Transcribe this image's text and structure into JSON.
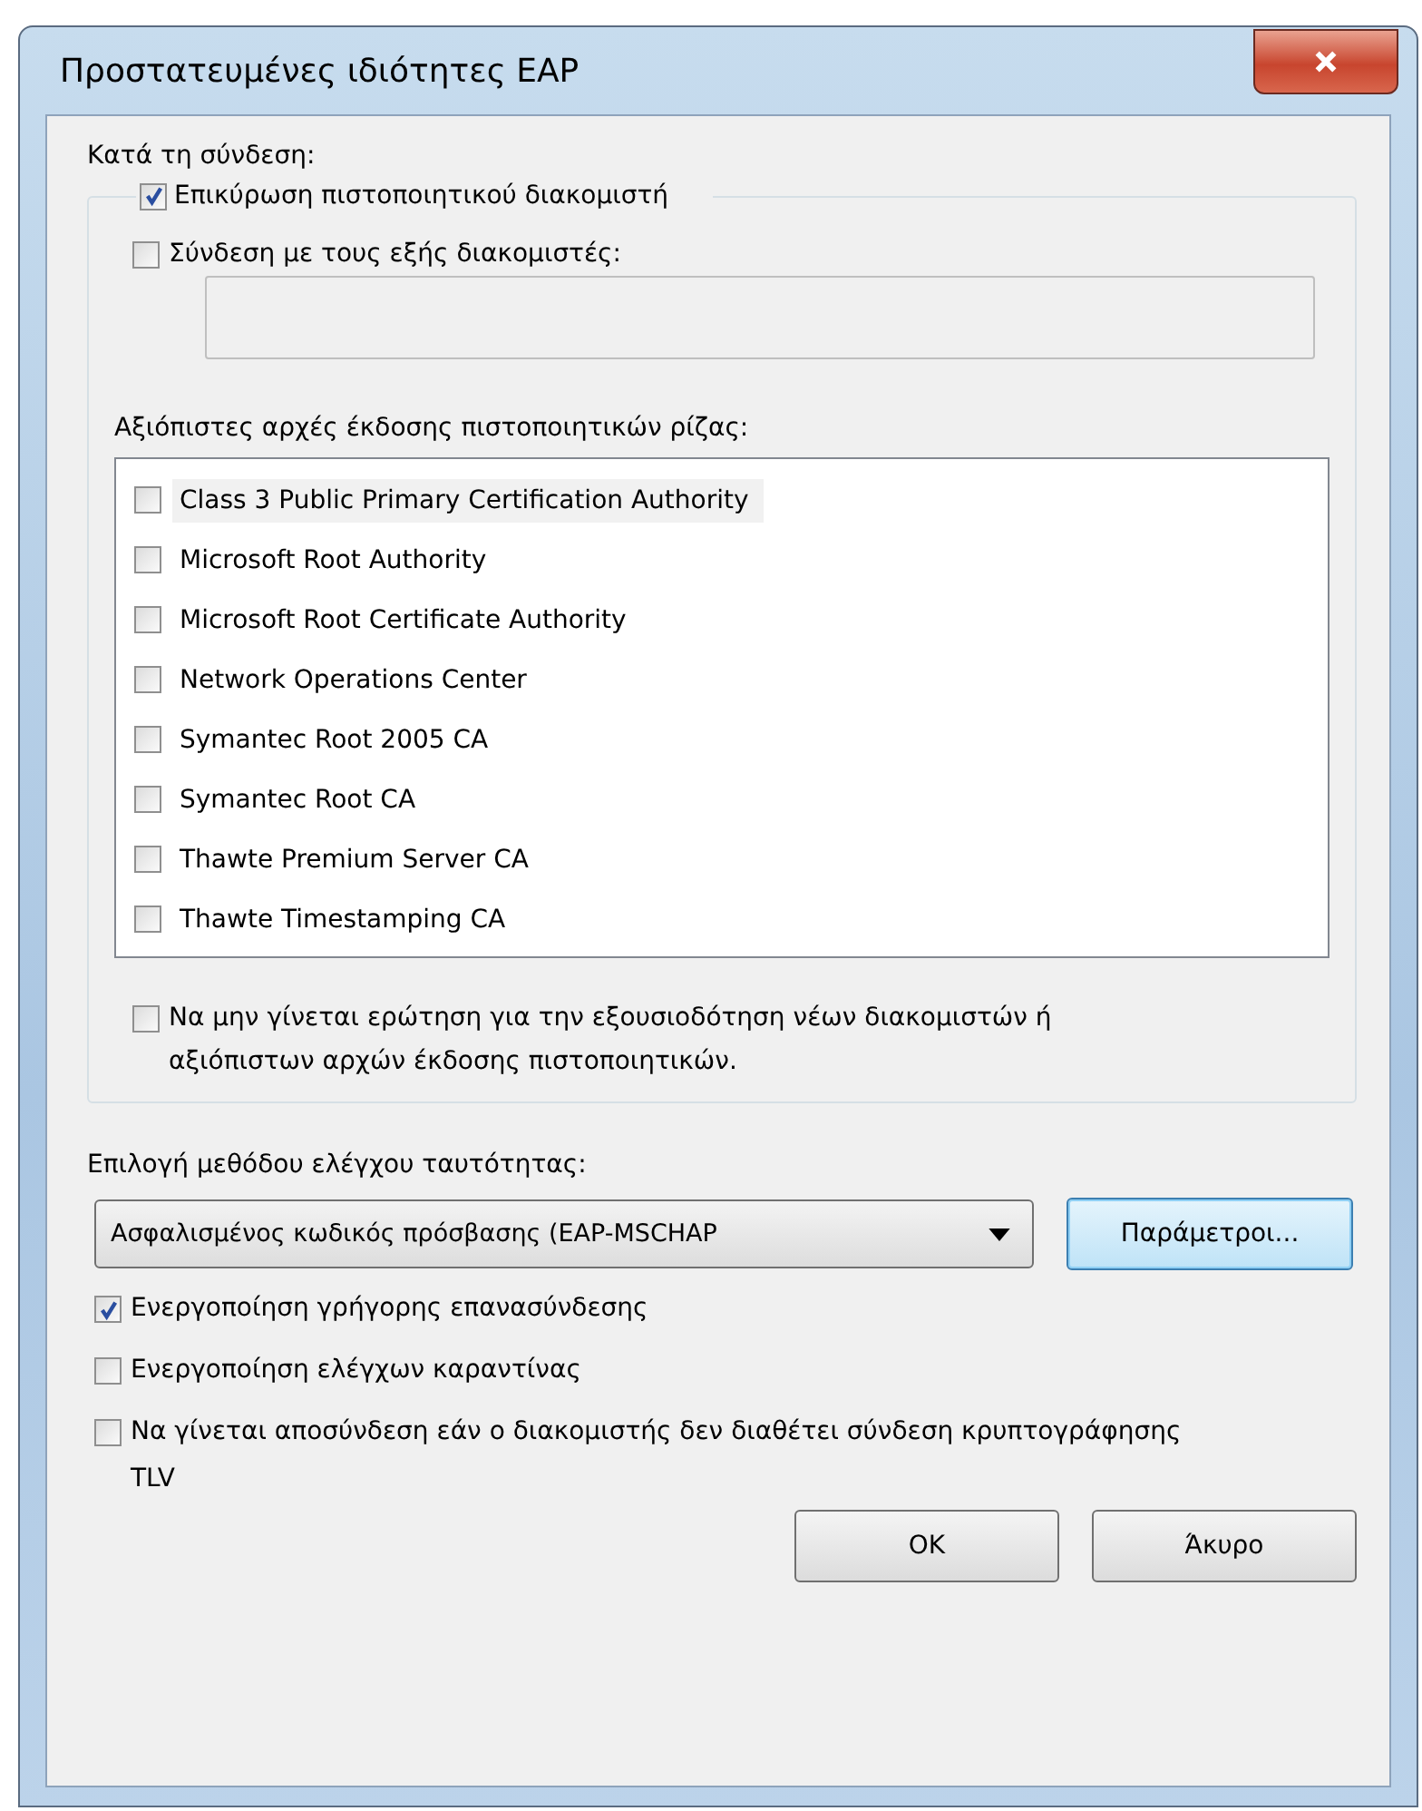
{
  "window": {
    "title": "Προστατευμένες ιδιότητες EAP"
  },
  "connect_label": "Κατά τη σύνδεση:",
  "validate": {
    "label": "Επικύρωση πιστοποιητικού διακομιστή",
    "checked": true
  },
  "servers": {
    "label": "Σύνδεση με τους εξής διακομιστές:",
    "checked": false
  },
  "roots_label": "Αξιόπιστες αρχές έκδοσης πιστοποιητικών ρίζας:",
  "roots": [
    {
      "label": "Class 3 Public Primary Certification Authority",
      "checked": false,
      "selected": true
    },
    {
      "label": "Microsoft Root Authority",
      "checked": false,
      "selected": false
    },
    {
      "label": "Microsoft Root Certificate Authority",
      "checked": false,
      "selected": false
    },
    {
      "label": "Network Operations Center",
      "checked": false,
      "selected": false
    },
    {
      "label": "Symantec Root 2005 CA",
      "checked": false,
      "selected": false
    },
    {
      "label": "Symantec Root CA",
      "checked": false,
      "selected": false
    },
    {
      "label": "Thawte Premium Server CA",
      "checked": false,
      "selected": false
    },
    {
      "label": "Thawte Timestamping CA",
      "checked": false,
      "selected": false
    }
  ],
  "no_prompt": {
    "label": "Να μην γίνεται ερώτηση για την εξουσιοδότηση νέων διακομιστών ή αξιόπιστων αρχών έκδοσης πιστοποιητικών.",
    "checked": false
  },
  "method_label": "Επιλογή μεθόδου ελέγχου ταυτότητας:",
  "method": {
    "value": "Ασφαλισμένος κωδικός πρόσβασης (EAP-MSCHAP"
  },
  "params_button": "Παράμετροι...",
  "options": [
    {
      "label": "Ενεργοποίηση γρήγορης επανασύνδεσης",
      "checked": true
    },
    {
      "label": "Ενεργοποίηση ελέγχων καραντίνας",
      "checked": false
    },
    {
      "label": "Να γίνεται αποσύνδεση εάν ο διακομιστής δεν διαθέτει σύνδεση κρυπτογράφησης TLV",
      "checked": false
    }
  ],
  "buttons": [
    "OK",
    "Άκυρο"
  ]
}
